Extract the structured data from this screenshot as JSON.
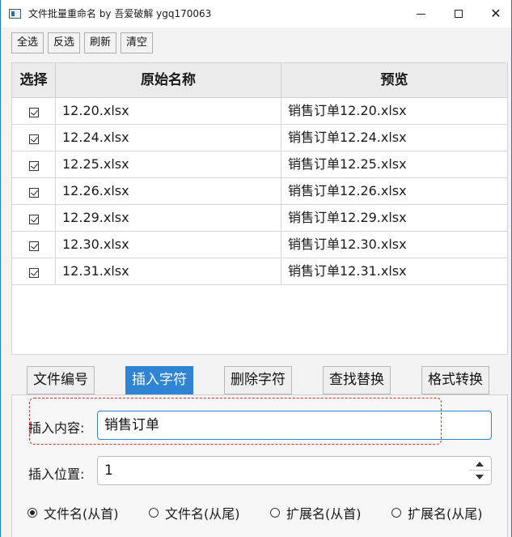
{
  "window": {
    "title": "文件批量重命名 by 吾爱破解 ygq170063"
  },
  "toolbar": {
    "select_all": "全选",
    "invert": "反选",
    "refresh": "刷新",
    "clear": "清空"
  },
  "table": {
    "headers": [
      "选择",
      "原始名称",
      "预览"
    ],
    "rows": [
      {
        "checked": true,
        "name": "12.20.xlsx",
        "preview": "销售订单12.20.xlsx"
      },
      {
        "checked": true,
        "name": "12.24.xlsx",
        "preview": "销售订单12.24.xlsx"
      },
      {
        "checked": true,
        "name": "12.25.xlsx",
        "preview": "销售订单12.25.xlsx"
      },
      {
        "checked": true,
        "name": "12.26.xlsx",
        "preview": "销售订单12.26.xlsx"
      },
      {
        "checked": true,
        "name": "12.29.xlsx",
        "preview": "销售订单12.29.xlsx"
      },
      {
        "checked": true,
        "name": "12.30.xlsx",
        "preview": "销售订单12.30.xlsx"
      },
      {
        "checked": true,
        "name": "12.31.xlsx",
        "preview": "销售订单12.31.xlsx"
      }
    ]
  },
  "tabs": [
    "文件编号",
    "插入字符",
    "删除字符",
    "查找替换",
    "格式转换"
  ],
  "active_tab": "插入字符",
  "insert": {
    "content_label": "插入内容:",
    "content_value": "销售订单",
    "position_label": "插入位置:",
    "position_value": "1"
  },
  "radios": [
    {
      "label": "文件名(从首)",
      "selected": true
    },
    {
      "label": "文件名(从尾)",
      "selected": false
    },
    {
      "label": "扩展名(从首)",
      "selected": false
    },
    {
      "label": "扩展名(从尾)",
      "selected": false
    }
  ],
  "colors": {
    "accent": "#2f84d4",
    "highlight": "#d42b2b"
  }
}
